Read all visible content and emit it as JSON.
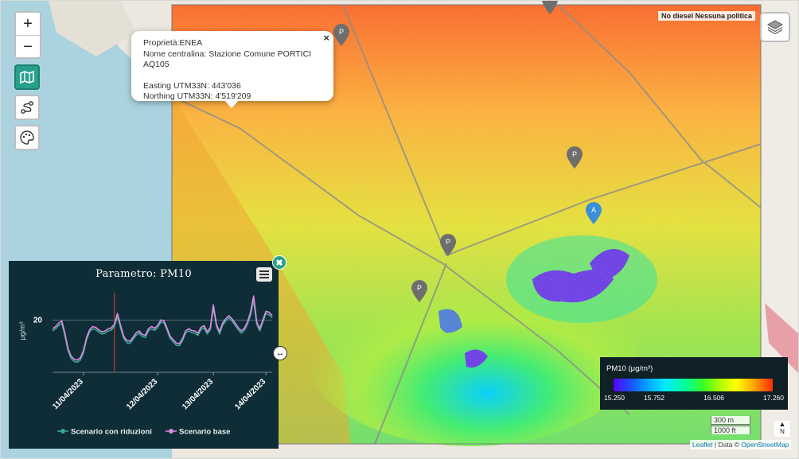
{
  "map": {
    "zoom_in_label": "+",
    "zoom_out_label": "−",
    "scenario_label": "No diesel Nessuna politica",
    "attribution_prefix": "Leaflet",
    "attribution_sep": " | Data © ",
    "attribution_osm": "OpenStreetMap",
    "scale_metric": "300 m",
    "scale_imperial": "1000 ft",
    "north_label": "N"
  },
  "popup": {
    "line1": "Proprietà:ENEA",
    "line2": "Nome centralina: Stazione Comune PORTICI AQ105",
    "line3": "Easting UTM33N: 443'036",
    "line4": "Northing UTM33N: 4'519'209",
    "close": "×"
  },
  "markers": [
    {
      "label": "P",
      "color": "#6e6e6e"
    },
    {
      "label": "P",
      "color": "#6e6e6e"
    },
    {
      "label": "A",
      "color": "#3b8fd6"
    },
    {
      "label": "P",
      "color": "#6e6e6e"
    },
    {
      "label": "P",
      "color": "#6e6e6e"
    },
    {
      "label": "",
      "color": "#6e6e6e"
    }
  ],
  "panel": {
    "title": "Parametro: PM10",
    "close": "✖",
    "resize": "↔",
    "legend_reduced": "Scenario con riduzioni",
    "legend_base": "Scenario base"
  },
  "chart_data": {
    "type": "line",
    "title": "Parametro: PM10",
    "ylabel": "μg/m³",
    "yticks": [
      20
    ],
    "xtick_labels": [
      "11/04/2023",
      "12/04/2023",
      "13/04/2023",
      "14/04/2023"
    ],
    "series": [
      {
        "name": "Scenario con riduzioni",
        "color": "#3aa59a",
        "values": [
          17.5,
          18,
          18.8,
          19.2,
          16.5,
          13,
          11.2,
          10.5,
          10.3,
          10.8,
          12.5,
          15.5,
          17.3,
          18,
          17.8,
          17.2,
          16.8,
          17,
          17.5,
          17.7,
          18.5,
          20.8,
          18.2,
          15.8,
          14.8,
          14.6,
          15.5,
          16.5,
          17,
          16.2,
          16,
          17.5,
          18,
          17.6,
          18.3,
          19.5,
          19.4,
          17.7,
          15.8,
          15,
          14.2,
          14.1,
          15.2,
          17,
          17.5,
          17.1,
          17,
          16.5,
          17.8,
          18.2,
          16.8,
          17.8,
          22.8,
          18.5,
          16.8,
          18.8,
          19.8,
          20.5,
          19.8,
          18.8,
          17.8,
          17,
          17.6,
          19,
          21,
          24.5,
          19,
          17.5,
          19.5,
          21.5,
          21.2,
          20.5
        ]
      },
      {
        "name": "Scenario base",
        "color": "#e08ae0",
        "values": [
          18,
          18.5,
          19.3,
          19.8,
          17,
          13.5,
          11.7,
          11,
          10.8,
          11.3,
          13,
          16,
          17.8,
          18.5,
          18.3,
          17.7,
          17.3,
          17.5,
          18,
          18.2,
          19,
          21.5,
          18.8,
          16.3,
          15.3,
          15.1,
          16,
          17,
          17.5,
          16.7,
          16.5,
          18,
          18.5,
          18.1,
          18.8,
          20,
          19.9,
          18.2,
          16.3,
          15.5,
          14.7,
          14.6,
          15.7,
          17.5,
          18,
          17.6,
          17.5,
          17,
          18.3,
          18.7,
          17.3,
          18.3,
          23.5,
          19,
          17.3,
          19.3,
          20.3,
          21,
          20.3,
          19.3,
          18.3,
          17.5,
          18.1,
          19.5,
          21.8,
          25.5,
          19.6,
          18,
          20,
          22,
          21.8,
          21
        ]
      }
    ],
    "xrange": [
      0,
      71
    ],
    "ylim": [
      8,
      27
    ],
    "marker_index": 20,
    "grid": true,
    "legend_position": "bottom"
  },
  "legend": {
    "title": "PM10 (μg/m³)",
    "ticks": [
      "15.250",
      "15.752",
      "16.506",
      "17.260"
    ],
    "ticks_pos": [
      0,
      0.25,
      0.625,
      1.0
    ]
  },
  "colors": {
    "accent": "#27a08d",
    "panel_bg": "#0f2d36",
    "legend_bg": "#0f2026",
    "now_line": "#c0392b"
  },
  "icons": {
    "layers": "layers-icon",
    "tool1": "map-icon",
    "tool2": "route-icon",
    "tool3": "palette-icon"
  }
}
